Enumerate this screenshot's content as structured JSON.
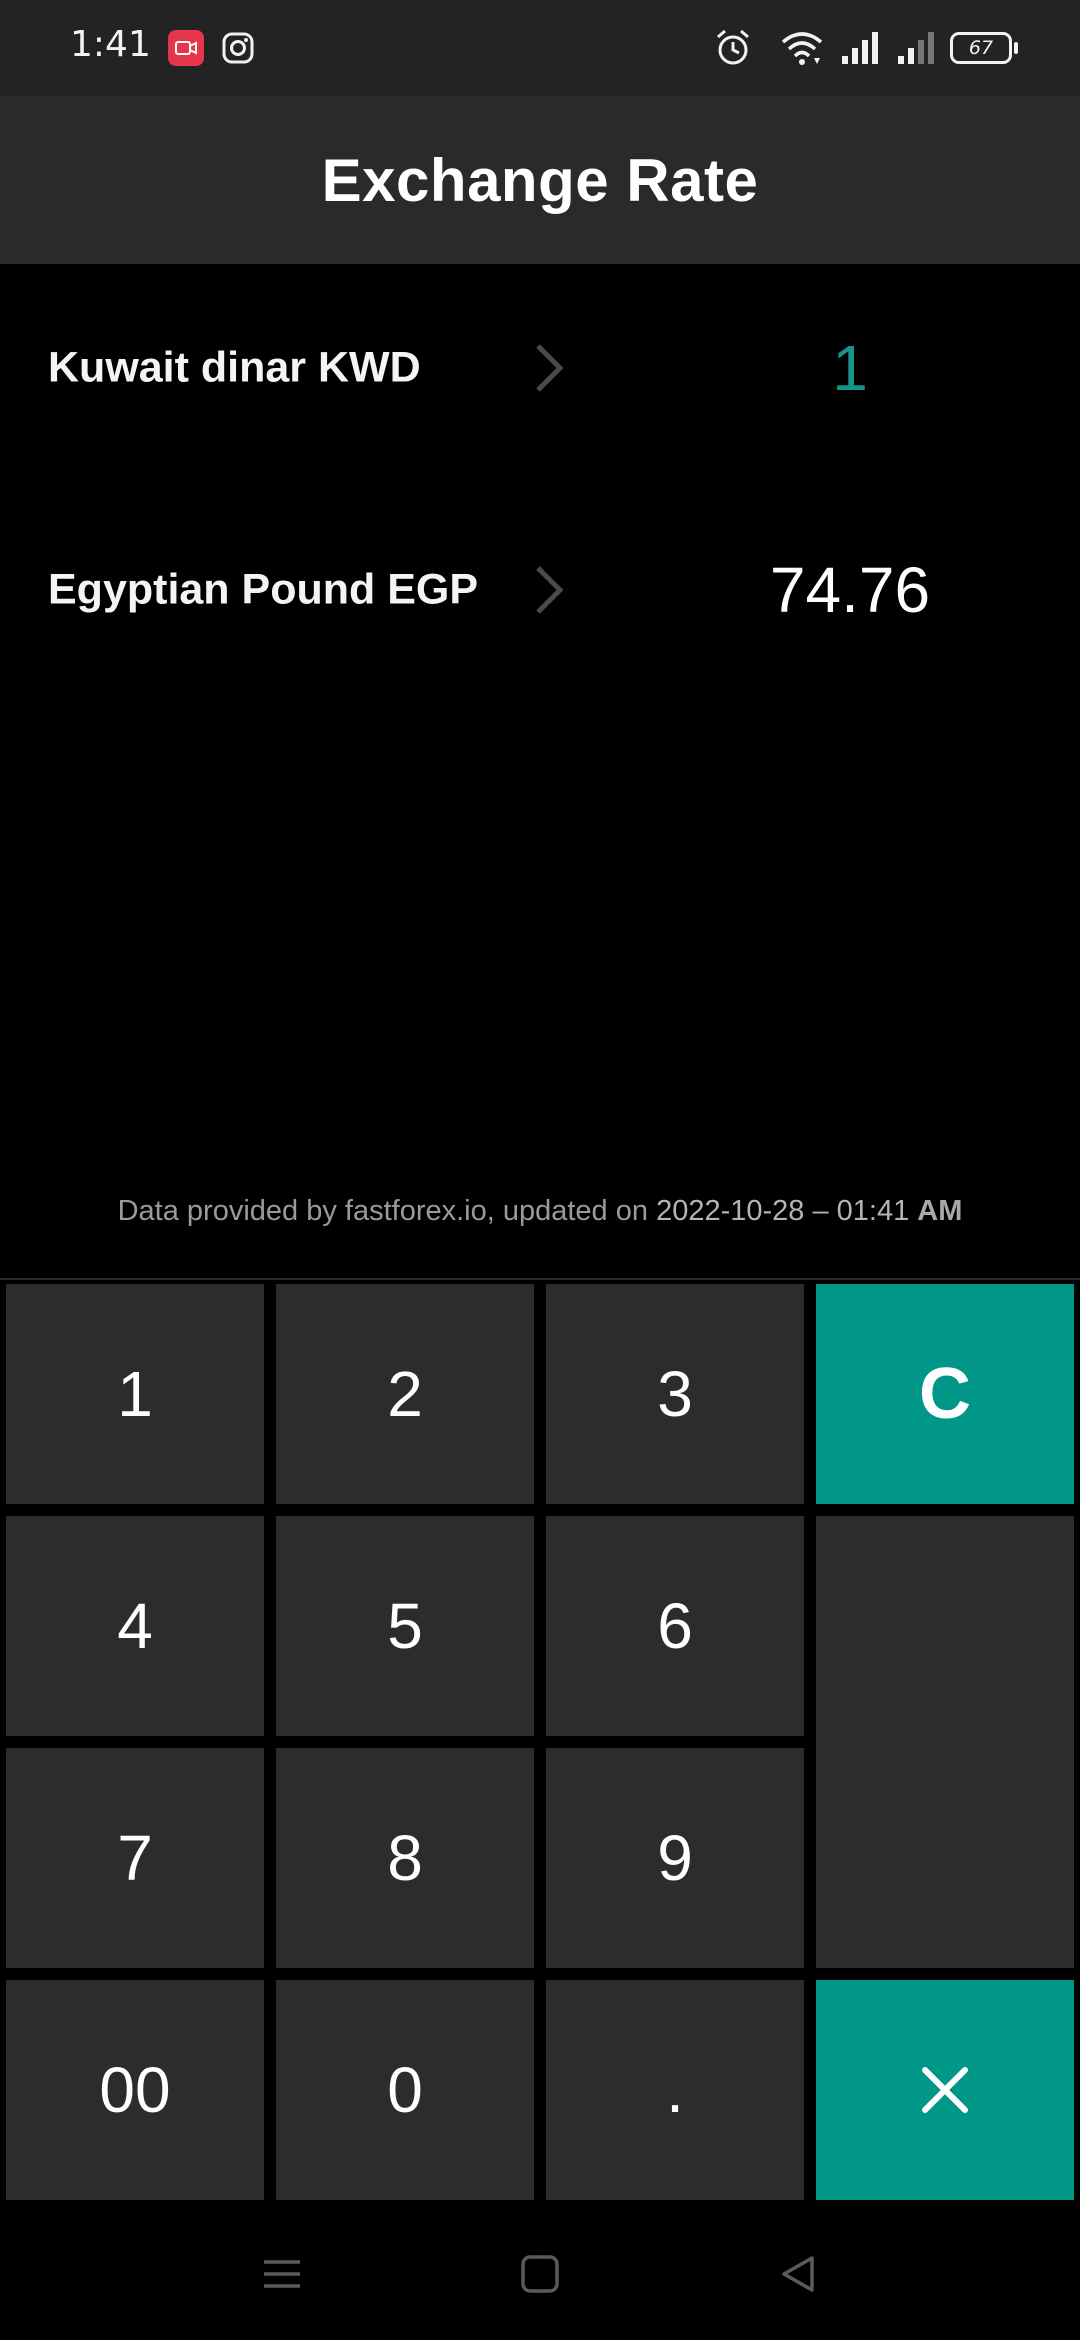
{
  "status_bar": {
    "time": "1:41",
    "battery": "67",
    "icons": [
      "screen-record-icon",
      "instagram-icon",
      "alarm-icon",
      "wifi-icon",
      "signal-icon",
      "signal-icon-2",
      "battery-icon"
    ]
  },
  "app_bar": {
    "title": "Exchange Rate"
  },
  "currencies": [
    {
      "name": "Kuwait dinar KWD",
      "value": "1",
      "color": "#16948a"
    },
    {
      "name": "Egyptian Pound EGP",
      "value": "74.76",
      "color": "#ffffff"
    }
  ],
  "data_note": {
    "prefix": "Data provided by fastforex.io, updated on",
    "date": "2022-10-28 – 01:41",
    "ampm": "AM"
  },
  "keypad": {
    "k1": "1",
    "k2": "2",
    "k3": "3",
    "clear": "C",
    "k4": "4",
    "k5": "5",
    "k6": "6",
    "k7": "7",
    "k8": "8",
    "k9": "9",
    "k00": "00",
    "k0": "0",
    "dot": "."
  },
  "colors": {
    "accent": "#009688",
    "key_bg": "#2c2c2e",
    "app_bar_bg": "#2a2a2c"
  },
  "nav_bar": {
    "icons": [
      "menu-icon",
      "home-icon",
      "back-icon"
    ]
  }
}
